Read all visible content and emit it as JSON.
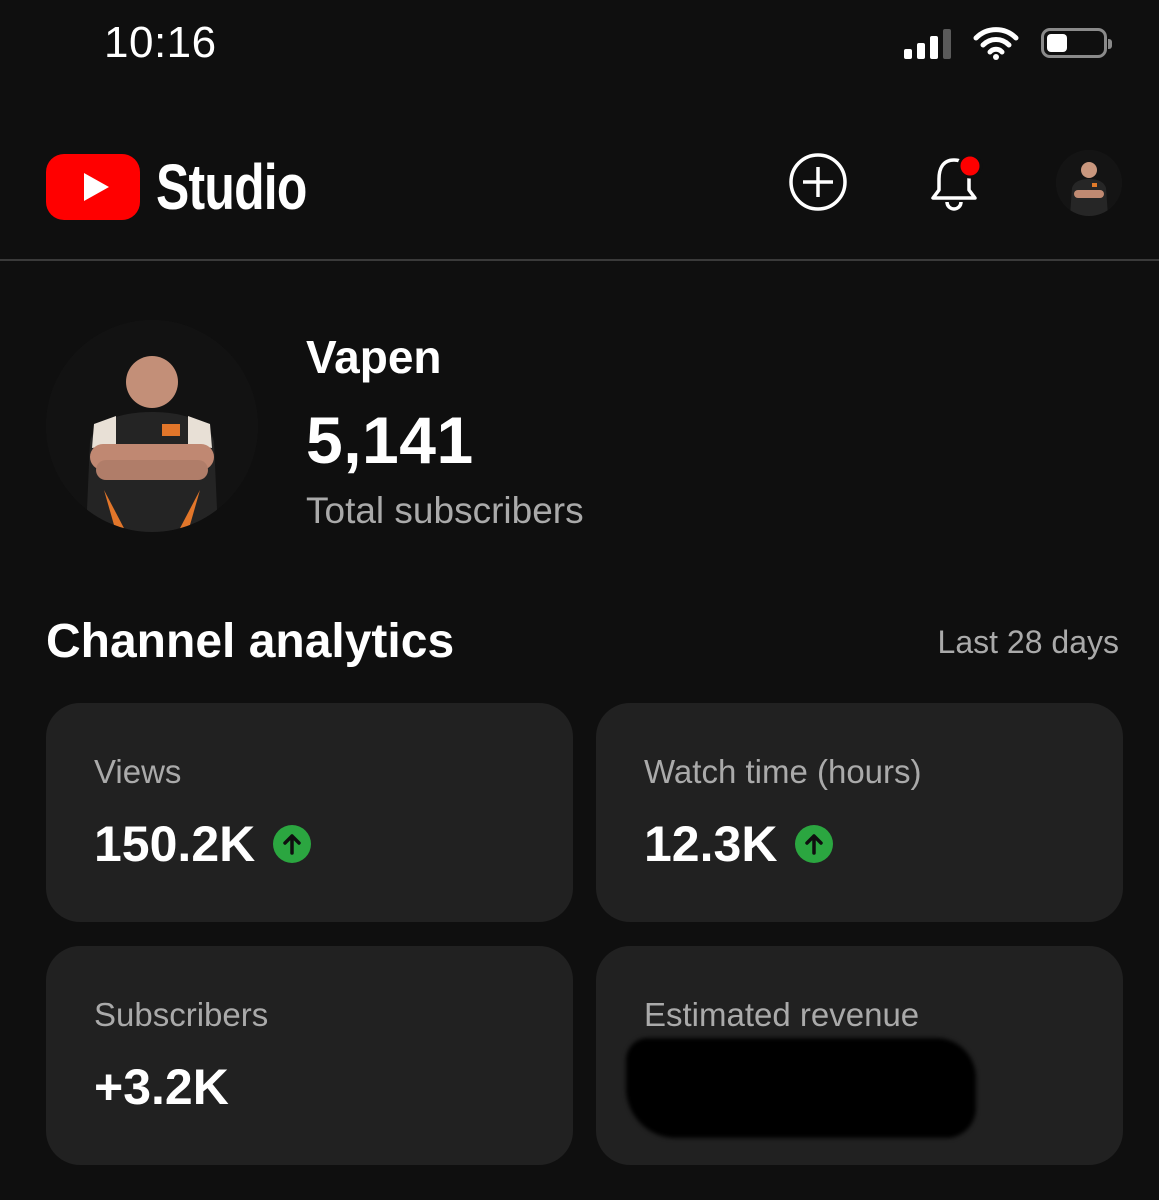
{
  "status_bar": {
    "time": "10:16",
    "battery_percent": 35
  },
  "header": {
    "logo_text": "Studio",
    "brand_color": "#ff0000",
    "icons": [
      "create-icon",
      "notifications-icon",
      "account-avatar"
    ],
    "notification_dot_color": "#ff0000"
  },
  "channel": {
    "name": "Vapen",
    "subscribers": "5,141",
    "subscribers_label": "Total subscribers"
  },
  "analytics": {
    "title": "Channel analytics",
    "period": "Last 28 days",
    "cards": [
      {
        "label": "Views",
        "value": "150.2K",
        "trend": "up"
      },
      {
        "label": "Watch time (hours)",
        "value": "12.3K",
        "trend": "up"
      },
      {
        "label": "Subscribers",
        "value": "+3.2K",
        "trend": "none"
      },
      {
        "label": "Estimated revenue",
        "value": "",
        "redacted": true
      }
    ],
    "trend_up_color": "#2ba640"
  }
}
